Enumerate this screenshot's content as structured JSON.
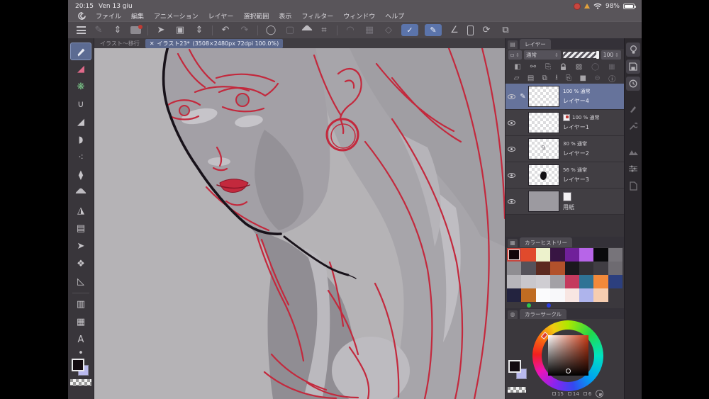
{
  "statusbar": {
    "time": "20:15",
    "date": "Ven 13 giu",
    "battery_percent": "98%"
  },
  "menubar": {
    "items": [
      "ファイル",
      "編集",
      "アニメーション",
      "レイヤー",
      "選択範囲",
      "表示",
      "フィルター",
      "ウィンドウ",
      "ヘルプ"
    ]
  },
  "tabs": {
    "inactive": "イラスト〜移行",
    "close_glyph": "✕",
    "active_title": "イラスト23*",
    "active_info": "(3508×2480px 72dpi 100.0%)"
  },
  "icons": {
    "pen": "✎",
    "collapse": "⇕",
    "undo": "↶",
    "redo": "↷",
    "deselect": "◯",
    "select_rect": "▢",
    "select_poly": "◇",
    "crop": "⌗",
    "arc": "◠",
    "grid": "▦",
    "check": "✓",
    "brush": "✎",
    "angle": "∠",
    "rotate": "⟳",
    "export": "⧉",
    "folder": "▣",
    "info": "ⓘ",
    "text_tool": "A",
    "stitch": "∪",
    "eraser": "◢",
    "blendtool": "◗",
    "spray": "⁖",
    "dropper": "⧫",
    "figure": "◮",
    "frame": "▤",
    "cursor": "➤",
    "object": "❖",
    "ruler": "◺",
    "gradient": "▥",
    "border": "▦",
    "dot": "•",
    "clip": "◧",
    "lockalpha": "▨",
    "twopage": "⎘",
    "people": "⚯",
    "newlayer": "▱",
    "newfolder": "▤",
    "dup": "⧉",
    "merge": "⭳",
    "mask": "■",
    "del": "⊖",
    "layers_tab": "▤",
    "palette_tab": "▦",
    "wheel_tab": "◍",
    "lightbulb": "☉",
    "wrench": "⚒",
    "sliders": "≋",
    "page": "▯",
    "clock": "◷",
    "save": "▣",
    "mountain": "⛰"
  },
  "layer_panel": {
    "tab": "レイヤー",
    "blend_mode": "通常",
    "opacity_value": "100",
    "layers": [
      {
        "line1": "100 % 通常",
        "name": "レイヤー4"
      },
      {
        "line1": "100 % 通常",
        "name": "レイヤー1"
      },
      {
        "line1": "30 % 通常",
        "name": "レイヤー2"
      },
      {
        "line1": "56 % 通常",
        "name": "レイヤー3"
      },
      {
        "line1": "",
        "name": "用紙"
      }
    ]
  },
  "color_history": {
    "tab": "カラーヒストリー",
    "swatches": [
      "#120609",
      "#e04a2c",
      "#edf2cc",
      "#381543",
      "#70209a",
      "#b765e8",
      "#0a0a0c",
      "#77747a",
      "#8f8d92",
      "#55525a",
      "#5c2a20",
      "#b2512b",
      "#1a181d",
      "#333136",
      "#403d43",
      "#6e6b71",
      "#b7b5ba",
      "#c9c7cc",
      "#cfcdd2",
      "#a3a1a6",
      "#c43a5e",
      "#2f7395",
      "#f2893a",
      "#2c3f7e",
      "#23233f",
      "#c06c22",
      "#fbfbfd",
      "#f8f8fa",
      "#f8e6e2",
      "#aeb4ec",
      "#f6cdb0",
      "#3b383d"
    ],
    "extra_dots": [
      "#2ec44a",
      "#2a3de0"
    ]
  },
  "color_circle": {
    "tab": "カラーサークル",
    "readout": {
      "r": "15",
      "g": "14",
      "b": "6"
    },
    "foreground": "#120a10",
    "background": "#b9b9ee"
  },
  "canvas": {
    "accent_red": "#c3293d",
    "base_gray": "#b5b3b6"
  }
}
